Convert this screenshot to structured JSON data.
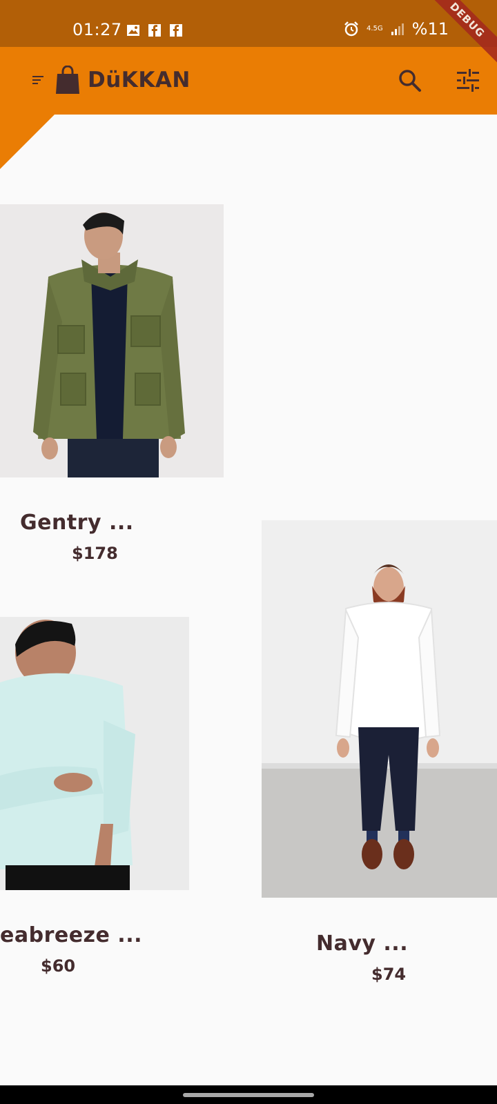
{
  "status_bar": {
    "time": "01:27",
    "battery": "%11",
    "network": "4.5G"
  },
  "debug_banner": "DEBUG",
  "app_bar": {
    "title": "DüKKAN",
    "icons": [
      "menu-icon",
      "shopping-bag-icon",
      "search-icon",
      "tune-icon"
    ]
  },
  "colors": {
    "status_bar": "#b25f07",
    "app_bar": "#ea7d04",
    "text": "#442c2e",
    "background": "#fafafa"
  },
  "products": [
    {
      "name": "Gentry ...",
      "price": "$178"
    },
    {
      "name": "Navy ...",
      "price": "$74"
    },
    {
      "name": "eabreeze ...",
      "price": "$60"
    }
  ]
}
